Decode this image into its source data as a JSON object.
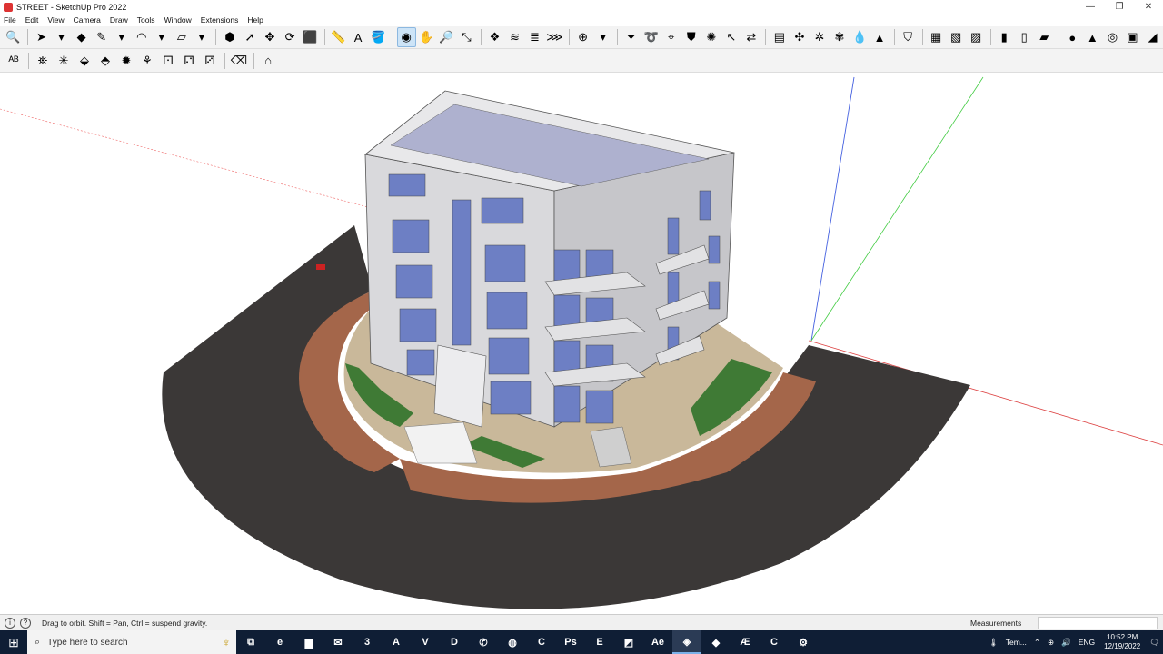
{
  "window": {
    "title": "STREET - SketchUp Pro 2022",
    "minimize": "—",
    "restore": "❐",
    "close": "✕"
  },
  "menu": [
    "File",
    "Edit",
    "View",
    "Camera",
    "Draw",
    "Tools",
    "Window",
    "Extensions",
    "Help"
  ],
  "toolbar1": [
    {
      "name": "zoom-extents-icon",
      "glyph": "🔍"
    },
    {
      "sep": true
    },
    {
      "name": "select-icon",
      "glyph": "➤"
    },
    {
      "name": "select-dropdown-icon",
      "glyph": "▾"
    },
    {
      "name": "eraser-icon",
      "glyph": "◆"
    },
    {
      "name": "pencil-icon",
      "glyph": "✎"
    },
    {
      "name": "pencil-dropdown-icon",
      "glyph": "▾"
    },
    {
      "name": "arc-icon",
      "glyph": "◠"
    },
    {
      "name": "arc-dropdown-icon",
      "glyph": "▾"
    },
    {
      "name": "rectangle-icon",
      "glyph": "▱"
    },
    {
      "name": "rectangle-dropdown-icon",
      "glyph": "▾"
    },
    {
      "sep": true
    },
    {
      "name": "push-pull-icon",
      "glyph": "⬢"
    },
    {
      "name": "follow-me-icon",
      "glyph": "➚"
    },
    {
      "name": "move-icon",
      "glyph": "✥"
    },
    {
      "name": "rotate-icon",
      "glyph": "⟳"
    },
    {
      "name": "scale-icon",
      "glyph": "⬛"
    },
    {
      "sep": true
    },
    {
      "name": "tape-measure-icon",
      "glyph": "📏"
    },
    {
      "name": "text-icon",
      "glyph": "A"
    },
    {
      "name": "paint-bucket-icon",
      "glyph": "🪣"
    },
    {
      "sep": true
    },
    {
      "name": "orbit-icon",
      "glyph": "◉",
      "active": true
    },
    {
      "name": "pan-icon",
      "glyph": "✋"
    },
    {
      "name": "zoom-icon",
      "glyph": "🔎"
    },
    {
      "name": "zoom-window-icon",
      "glyph": "⤡"
    },
    {
      "sep": true
    },
    {
      "name": "sandbox-icon",
      "glyph": "❖"
    },
    {
      "name": "smoove-icon",
      "glyph": "≋"
    },
    {
      "name": "stamp-icon",
      "glyph": "≣"
    },
    {
      "name": "drape-icon",
      "glyph": "⋙"
    },
    {
      "sep": true
    },
    {
      "name": "warehouse-icon",
      "glyph": "⊕"
    },
    {
      "name": "warehouse-dropdown-icon",
      "glyph": "▾"
    },
    {
      "sep": true
    },
    {
      "name": "filter-icon",
      "glyph": "⏷"
    },
    {
      "name": "lasso-icon",
      "glyph": "➰"
    },
    {
      "name": "select-tool-icon",
      "glyph": "⌖"
    },
    {
      "name": "shield-icon",
      "glyph": "⛊"
    },
    {
      "name": "gear-select-icon",
      "glyph": "✺"
    },
    {
      "name": "cursor-select-icon",
      "glyph": "↖"
    },
    {
      "name": "arrows-icon",
      "glyph": "⇄"
    },
    {
      "sep": true
    },
    {
      "name": "align-icon",
      "glyph": "▤"
    },
    {
      "name": "explode-icon",
      "glyph": "✣"
    },
    {
      "name": "scatter-icon",
      "glyph": "✲"
    },
    {
      "name": "paint-splash-icon",
      "glyph": "✾"
    },
    {
      "name": "drop-icon",
      "glyph": "💧"
    },
    {
      "name": "tree-icon",
      "glyph": "▲"
    },
    {
      "sep": true
    },
    {
      "name": "shield-badge-icon",
      "glyph": "⛉"
    },
    {
      "sep": true
    },
    {
      "name": "layer-stack-icon",
      "glyph": "▦"
    },
    {
      "name": "layer-add-icon",
      "glyph": "▧"
    },
    {
      "name": "layer-remove-icon",
      "glyph": "▨"
    },
    {
      "sep": true
    },
    {
      "name": "door-icon",
      "glyph": "▮"
    },
    {
      "name": "window-tool-icon",
      "glyph": "▯"
    },
    {
      "name": "wall-tool-icon",
      "glyph": "▰"
    },
    {
      "sep": true
    },
    {
      "name": "circle-shape-icon",
      "glyph": "●"
    },
    {
      "name": "cone-shape-icon",
      "glyph": "▲"
    },
    {
      "name": "torus-shape-icon",
      "glyph": "◎"
    },
    {
      "name": "box-shape-icon",
      "glyph": "▣"
    },
    {
      "name": "more-icon",
      "glyph": "◢"
    }
  ],
  "toolbar2": [
    {
      "name": "abc-text-icon",
      "glyph": "ᴬᴮ"
    },
    {
      "sep": true
    },
    {
      "name": "component-paint-icon",
      "glyph": "⛯"
    },
    {
      "name": "axis-icon",
      "glyph": "✳"
    },
    {
      "name": "cube-icon",
      "glyph": "⬙"
    },
    {
      "name": "material-icon",
      "glyph": "⬘"
    },
    {
      "name": "color-wheel-icon",
      "glyph": "✹"
    },
    {
      "name": "fan-icon",
      "glyph": "⚘"
    },
    {
      "name": "dice-1-icon",
      "glyph": "⚀"
    },
    {
      "name": "dice-2-icon",
      "glyph": "⚁"
    },
    {
      "name": "dice-3-icon",
      "glyph": "⚂"
    },
    {
      "sep": true
    },
    {
      "name": "eraser-brush-icon",
      "glyph": "⌫"
    },
    {
      "sep": true
    },
    {
      "name": "house-icon",
      "glyph": "⌂"
    }
  ],
  "status": {
    "hint": "Drag to orbit. Shift = Pan, Ctrl = suspend gravity.",
    "measurements_label": "Measurements"
  },
  "taskbar": {
    "search_placeholder": "Type here to search",
    "apps": [
      {
        "name": "task-view-icon",
        "glyph": "⧉"
      },
      {
        "name": "edge-icon",
        "glyph": "e"
      },
      {
        "name": "file-explorer-icon",
        "glyph": "▆"
      },
      {
        "name": "mail-icon",
        "glyph": "✉"
      },
      {
        "name": "app-3-icon",
        "glyph": "3"
      },
      {
        "name": "autocad-icon",
        "glyph": "A"
      },
      {
        "name": "v-app-icon",
        "glyph": "V"
      },
      {
        "name": "d-app-icon",
        "glyph": "D"
      },
      {
        "name": "whatsapp-icon",
        "glyph": "✆"
      },
      {
        "name": "chrome-icon",
        "glyph": "◍"
      },
      {
        "name": "camtasia-icon",
        "glyph": "C"
      },
      {
        "name": "photoshop-icon",
        "glyph": "Ps"
      },
      {
        "name": "epic-icon",
        "glyph": "E"
      },
      {
        "name": "note-icon",
        "glyph": "◩"
      },
      {
        "name": "after-effects-icon",
        "glyph": "Ae"
      },
      {
        "name": "sketchup-icon",
        "glyph": "◈",
        "active": true
      },
      {
        "name": "green-app-icon",
        "glyph": "◆"
      },
      {
        "name": "ae-circle-icon",
        "glyph": "Æ"
      },
      {
        "name": "red-app-icon",
        "glyph": "C"
      },
      {
        "name": "settings-icon",
        "glyph": "⚙"
      }
    ],
    "weather": "Tem...",
    "language": "ENG",
    "time": "10:52 PM",
    "date": "12/19/2022"
  }
}
